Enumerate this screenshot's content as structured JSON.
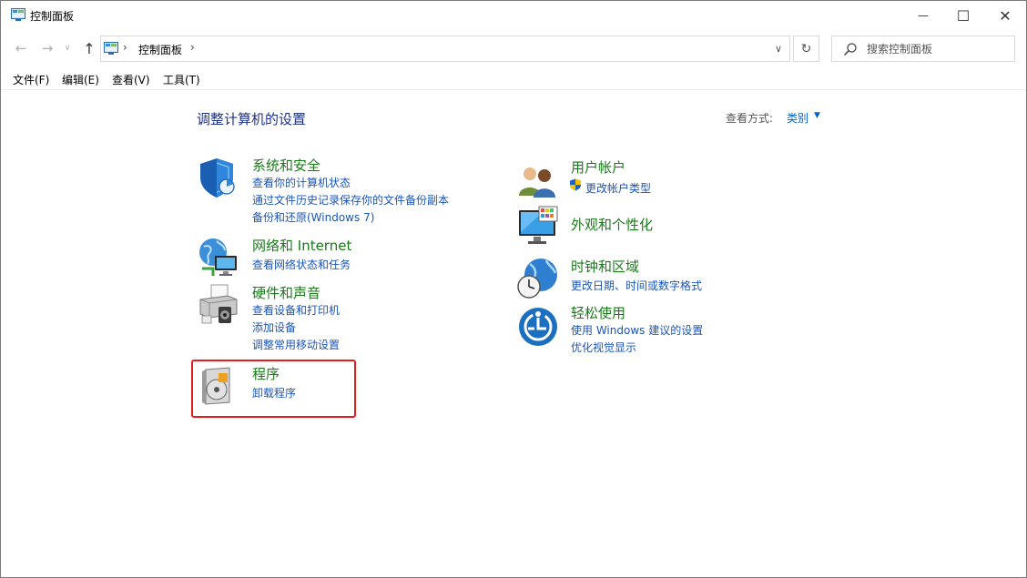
{
  "window": {
    "title": "控制面板",
    "controls": {
      "minimize": "—",
      "maximize": "☐",
      "close": "✕"
    }
  },
  "nav": {
    "back": "←",
    "forward": "→",
    "recent": "∨",
    "up": "↑",
    "address": {
      "crumb": "控制面板",
      "separator": "›",
      "dropdown": "∨"
    },
    "refresh": "↻",
    "search": {
      "placeholder": "搜索控制面板"
    }
  },
  "menu": {
    "items": [
      "文件(F)",
      "编辑(E)",
      "查看(V)",
      "工具(T)"
    ]
  },
  "main": {
    "title": "调整计算机的设置",
    "view_by": {
      "label": "查看方式:",
      "value": "类别",
      "caret": "▼"
    }
  },
  "categories": [
    {
      "title": "系统和安全",
      "icon": "shield-icon",
      "links": [
        "查看你的计算机状态",
        "通过文件历史记录保存你的文件备份副本",
        "备份和还原(Windows 7)"
      ]
    },
    {
      "title": "网络和 Internet",
      "icon": "network-icon",
      "links": [
        "查看网络状态和任务"
      ]
    },
    {
      "title": "硬件和声音",
      "icon": "printer-icon",
      "links": [
        "查看设备和打印机",
        "添加设备",
        "调整常用移动设置"
      ]
    },
    {
      "title": "程序",
      "icon": "programs-icon",
      "links": [
        "卸载程序"
      ]
    },
    {
      "title": "用户帐户",
      "icon": "users-icon",
      "links": [
        "更改帐户类型"
      ]
    },
    {
      "title": "外观和个性化",
      "icon": "monitor-icon",
      "links": []
    },
    {
      "title": "时钟和区域",
      "icon": "clock-globe-icon",
      "links": [
        "更改日期、时间或数字格式"
      ]
    },
    {
      "title": "轻松使用",
      "icon": "ease-of-access-icon",
      "links": [
        "使用 Windows 建议的设置",
        "优化视觉显示"
      ]
    }
  ],
  "colors": {
    "category_title": "#1a7a1a",
    "link": "#1c55b5",
    "page_title": "#1e3287",
    "highlight": "#e31c1c"
  }
}
